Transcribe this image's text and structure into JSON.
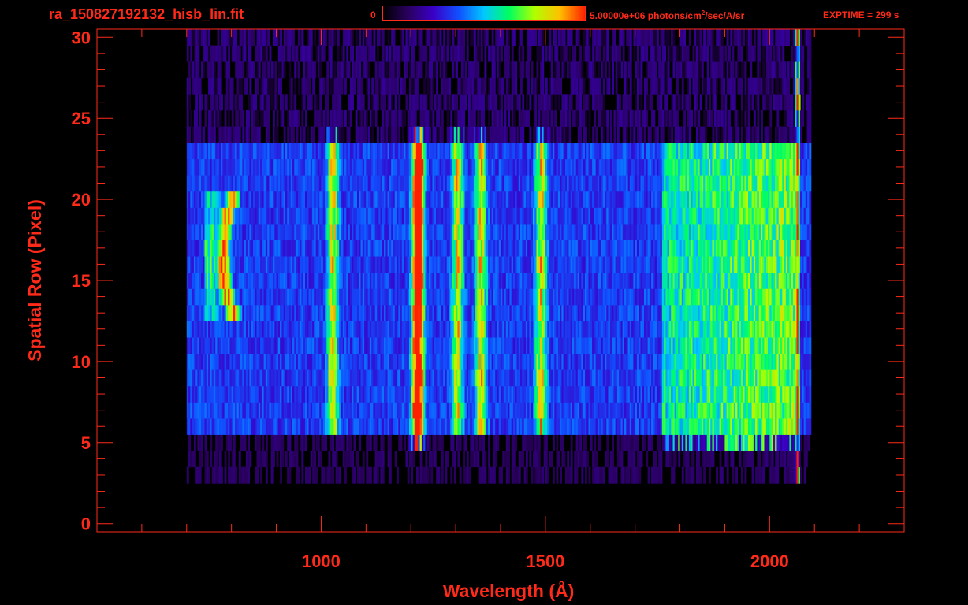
{
  "header": {
    "file_title": "ra_150827192132_hisb_lin.fit",
    "colorbar_min_label": "0",
    "colorbar_max_value": "5.00000e+06",
    "colorbar_unit_pre": "photons/cm",
    "colorbar_unit_sup": "2",
    "colorbar_unit_post": "/sec/A/sr",
    "exptime": "EXPTIME = 299 s"
  },
  "colors": {
    "axis": "#ff2a1a",
    "background": "#000000",
    "colormap": [
      "#000000",
      "#2a0060",
      "#3a00c8",
      "#1050ff",
      "#00c8ff",
      "#00ff60",
      "#b0ff00",
      "#ffc000",
      "#ff2000"
    ]
  },
  "chart_data": {
    "type": "heatmap",
    "title": "",
    "xlabel": "Wavelength (Å)",
    "ylabel": "Spatial Row (Pixel)",
    "xlim": [
      500,
      2300
    ],
    "ylim": [
      -0.5,
      30.5
    ],
    "x_ticks": [
      1000,
      1500,
      2000
    ],
    "y_ticks": [
      0,
      5,
      10,
      15,
      20,
      25,
      30
    ],
    "x_minor_step": 100,
    "y_minor_step": 1,
    "grid": false,
    "colorbar": {
      "min": 0,
      "max": 5000000,
      "unit": "photons/cm²/sec/A/sr",
      "position": "top"
    },
    "data_region": {
      "x_range": [
        700,
        2090
      ],
      "rows_faint": [
        3,
        30
      ],
      "rows_bright": [
        6,
        23
      ]
    },
    "features": [
      {
        "name": "arc",
        "x_center": 790,
        "intensity": "very high",
        "rows": [
          13,
          20
        ]
      },
      {
        "name": "line",
        "x_center": 1026,
        "intensity": "medium",
        "rows": [
          6,
          24
        ]
      },
      {
        "name": "line",
        "x_center": 1216,
        "intensity": "very high",
        "rows": [
          5,
          24
        ]
      },
      {
        "name": "line",
        "x_center": 1304,
        "intensity": "medium",
        "rows": [
          6,
          24
        ]
      },
      {
        "name": "line",
        "x_center": 1356,
        "intensity": "medium",
        "rows": [
          6,
          24
        ]
      },
      {
        "name": "line",
        "x_center": 1490,
        "intensity": "medium",
        "rows": [
          6,
          24
        ]
      },
      {
        "name": "continuum",
        "x_range": [
          1780,
          2060
        ],
        "intensity": "high",
        "rows": [
          5,
          23
        ]
      },
      {
        "name": "edge",
        "x_center": 2062,
        "intensity": "very high",
        "rows": [
          1,
          30
        ]
      }
    ]
  }
}
